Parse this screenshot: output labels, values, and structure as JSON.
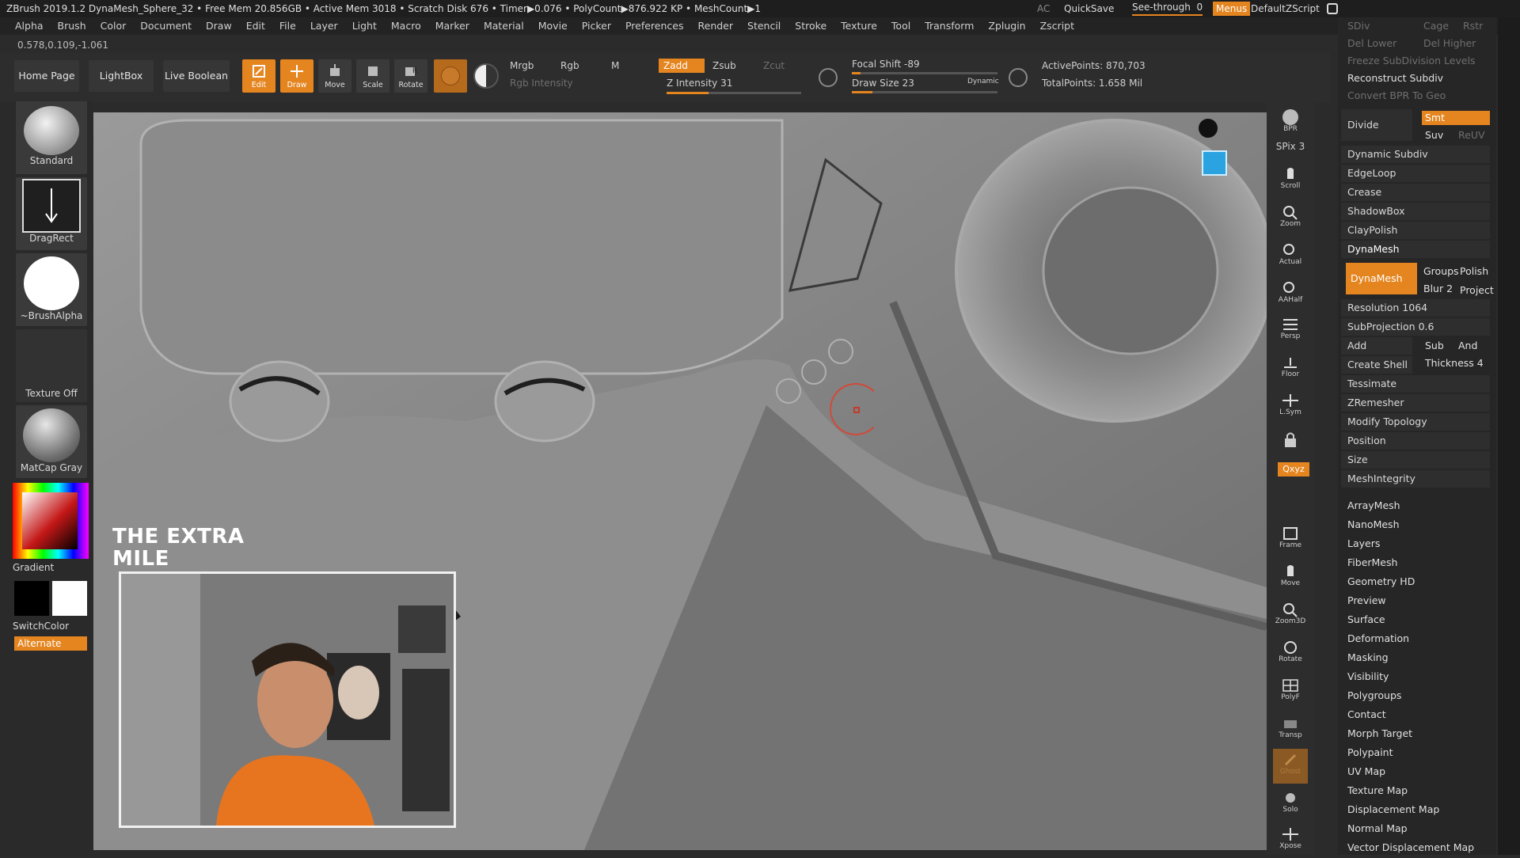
{
  "titlebar": {
    "text": "ZBrush 2019.1.2   DynaMesh_Sphere_32   • Free Mem 20.856GB • Active Mem 3018 • Scratch Disk 676 • Timer▶0.076 • PolyCount▶876.922 KP  • MeshCount▶1",
    "ac": "AC",
    "quicksave": "QuickSave",
    "see_through": "See-through",
    "see_through_value": "0",
    "menus": "Menus",
    "default_zscript": "DefaultZScript"
  },
  "menubar": [
    "Alpha",
    "Brush",
    "Color",
    "Document",
    "Draw",
    "Edit",
    "File",
    "Layer",
    "Light",
    "Macro",
    "Marker",
    "Material",
    "Movie",
    "Picker",
    "Preferences",
    "Render",
    "Stencil",
    "Stroke",
    "Texture",
    "Tool",
    "Transform",
    "Zplugin",
    "Zscript"
  ],
  "coords": "0.578,0.109,-1.061",
  "shelf": {
    "home_page": "Home Page",
    "lightbox": "LightBox",
    "live_boolean": "Live Boolean",
    "tools": [
      {
        "label": "Edit",
        "active": true
      },
      {
        "label": "Draw",
        "active": true
      },
      {
        "label": "Move",
        "active": false
      },
      {
        "label": "Scale",
        "active": false
      },
      {
        "label": "Rotate",
        "active": false
      }
    ],
    "mrgb": "Mrgb",
    "rgb": "Rgb",
    "m": "M",
    "rgb_intensity": "Rgb Intensity",
    "zadd": "Zadd",
    "zsub": "Zsub",
    "zcut": "Zcut",
    "z_intensity": "Z Intensity 31",
    "z_intensity_value": 31,
    "focal_shift": "Focal Shift -89",
    "draw_size": "Draw Size 23",
    "dynamic": "Dynamic",
    "active_points": "ActivePoints: 870,703",
    "total_points": "TotalPoints: 1.658 Mil"
  },
  "leftpanel": {
    "brush": "Standard",
    "stroke": "DragRect",
    "alpha": "~BrushAlpha",
    "texture": "Texture Off",
    "material": "MatCap Gray",
    "gradient": "Gradient",
    "switchcolor": "SwitchColor",
    "alternate": "Alternate"
  },
  "rtools": [
    {
      "name": "bpr-button",
      "label": "BPR"
    },
    {
      "name": "spix-button",
      "label": "SPix 3"
    },
    {
      "name": "scroll-button",
      "label": "Scroll"
    },
    {
      "name": "zoom-button",
      "label": "Zoom"
    },
    {
      "name": "actual-button",
      "label": "Actual"
    },
    {
      "name": "aahalf-button",
      "label": "AAHalf"
    },
    {
      "name": "persp-button",
      "label": "Persp"
    },
    {
      "name": "floor-button",
      "label": "Floor"
    },
    {
      "name": "lsym-button",
      "label": "L.Sym"
    },
    {
      "name": "lock-button",
      "label": ""
    },
    {
      "name": "xyz-button",
      "label": "Qxyz"
    },
    {
      "name": "frame-button",
      "label": "Frame"
    },
    {
      "name": "move-button",
      "label": "Move"
    },
    {
      "name": "zoom3d-button",
      "label": "Zoom3D"
    },
    {
      "name": "rotate-button",
      "label": "Rotate"
    },
    {
      "name": "polyf-button",
      "label": "PolyF"
    },
    {
      "name": "transp-button",
      "label": "Transp"
    },
    {
      "name": "ghost-button",
      "label": "Ghost"
    },
    {
      "name": "solo-button",
      "label": "Solo"
    },
    {
      "name": "xpose-button",
      "label": "Xpose"
    }
  ],
  "rpanel": {
    "sdiv": "SDiv",
    "cage": "Cage",
    "rstr": "Rstr",
    "del_lower": "Del Lower",
    "del_higher": "Del Higher",
    "freeze": "Freeze SubDivision Levels",
    "reconstruct": "Reconstruct Subdiv",
    "convert_bpr": "Convert BPR To Geo",
    "divide": "Divide",
    "smt": "Smt",
    "suv": "Suv",
    "reuv": "ReUV",
    "items_a": [
      "Dynamic Subdiv",
      "EdgeLoop",
      "Crease",
      "ShadowBox",
      "ClayPolish"
    ],
    "dynamesh_header": "DynaMesh",
    "dynamesh_btn": "DynaMesh",
    "groups": "Groups",
    "polish": "Polish",
    "blur": "Blur 2",
    "project": "Project",
    "resolution": "Resolution 1064",
    "subprojection": "SubProjection 0.6",
    "add": "Add",
    "sub": "Sub",
    "and": "And",
    "create_shell": "Create Shell",
    "thickness": "Thickness 4",
    "items_b": [
      "Tessimate",
      "ZRemesher",
      "Modify Topology",
      "Position",
      "Size",
      "MeshIntegrity"
    ],
    "items_c": [
      "ArrayMesh",
      "NanoMesh",
      "Layers",
      "FiberMesh",
      "Geometry HD",
      "Preview",
      "Surface",
      "Deformation",
      "Masking",
      "Visibility",
      "Polygroups",
      "Contact",
      "Morph Target",
      "Polypaint",
      "UV Map",
      "Texture Map",
      "Displacement Map",
      "Normal Map",
      "Vector Displacement Map"
    ]
  },
  "overlay": {
    "logo_line1": "THE EXTRA",
    "logo_line2": "MILE"
  },
  "colors": {
    "accent": "#e58520",
    "background": "#2b2b2b",
    "viewport": "#7f7f7f"
  }
}
